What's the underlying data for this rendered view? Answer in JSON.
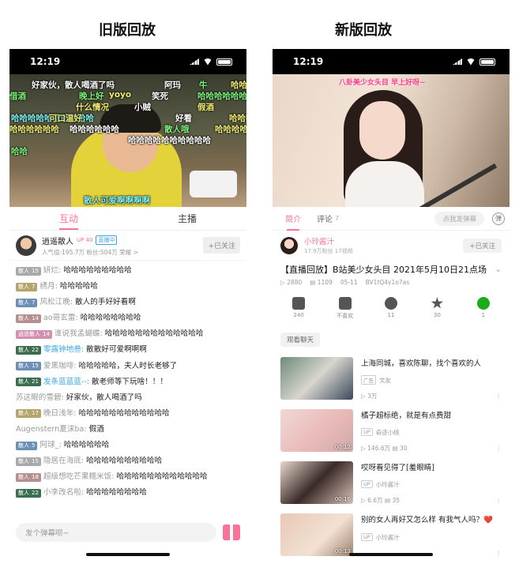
{
  "headings": {
    "old": "旧版回放",
    "new": "新版回放"
  },
  "status": {
    "time": "12:19"
  },
  "old": {
    "danmaku": [
      "好家伙，散人喝酒了吗",
      "阿玛",
      "牛",
      "哈哈",
      "借酒",
      "晚上好",
      "yoyo",
      "笑死",
      "哈哈哈哈哈哈",
      "什么情况",
      "小贼",
      "假酒",
      "哈哈哈哈哈哈哈哈哈哈",
      "可口温好",
      "好看",
      "哈哈哈哈哈",
      "哈哈哈哈哈哈",
      "哈哈哈哈哈哈",
      "散人哦",
      "哈哈哈哈哈",
      "哈哈哈哈哈哈哈哈哈哈",
      "哈哈",
      "散人可爱啊啊啊啊"
    ],
    "tabs": [
      "互动",
      "主播"
    ],
    "anchor": {
      "name": "逍遥散人",
      "level": "UP 40",
      "tag": "直播中",
      "sub": "人气值:195.7万  粉丝:504万  荣耀 >",
      "follow": "+已关注"
    },
    "chat": [
      {
        "medal": "散人",
        "lv": "15",
        "medal_color": "#a9a9a9",
        "user": "妍烂:",
        "text": "哈哈哈哈哈哈哈哈哈",
        "blue": false
      },
      {
        "medal": "散人",
        "lv": "7",
        "medal_color": "#b5a46b",
        "user": "绣月:",
        "text": "哈哈哈哈哈",
        "blue": false
      },
      {
        "medal": "散人",
        "lv": "7",
        "medal_color": "#6b8fb5",
        "user": "风松江晚:",
        "text": "散人的手好好看啊",
        "blue": false
      },
      {
        "medal": "散人",
        "lv": "14",
        "medal_color": "#b58f8f",
        "user": "ao哥玄雷:",
        "text": "哈哈哈哈哈哈哈哈",
        "blue": false
      },
      {
        "medal": "逍遥散人",
        "lv": "14",
        "medal_color": "#d38fb0",
        "user": "谁说我孟蝴蝶:",
        "text": "哈哈哈哈哈哈哈哈哈哈哈哈哈",
        "blue": false
      },
      {
        "medal": "散人",
        "lv": "22",
        "medal_color": "#3b6e4e",
        "user": "零露钟地叁:",
        "text": "散散好可爱啊啊啊",
        "blue": true
      },
      {
        "medal": "散人",
        "lv": "15",
        "medal_color": "#6b8fb5",
        "user": "爱黑咖啡:",
        "text": "哈哈哈哈哈，夫人时长老够了",
        "blue": false
      },
      {
        "medal": "散人",
        "lv": "21",
        "medal_color": "#3b6e4e",
        "user": "发条蓝蓝蓝--:",
        "text": "散老师等下玩啥！！！",
        "blue": true
      },
      {
        "medal": "",
        "lv": "",
        "medal_color": "",
        "user": "苏这眼的雪碧:",
        "text": "好家伙，散人喝酒了吗",
        "blue": false
      },
      {
        "medal": "散人",
        "lv": "17",
        "medal_color": "#b5a46b",
        "user": "晚日浅年:",
        "text": "哈哈哈哈哈哈哈哈哈哈哈哈",
        "blue": false
      },
      {
        "medal": "",
        "lv": "",
        "medal_color": "",
        "user": "Augenstern夏沫ba:",
        "text": "假酒",
        "blue": false
      },
      {
        "medal": "散人",
        "lv": "5",
        "medal_color": "#6b8fb5",
        "user": "阿球_:",
        "text": "哈哈哈哈哈哈",
        "blue": false
      },
      {
        "medal": "散人",
        "lv": "15",
        "medal_color": "#a9a9a9",
        "user": "隐居在海底:",
        "text": "哈哈哈哈哈哈哈哈哈哈",
        "blue": false
      },
      {
        "medal": "散人",
        "lv": "18",
        "medal_color": "#b58f8f",
        "user": "超级想吃芒果糯米饭:",
        "text": "哈哈哈哈哈哈哈哈哈哈哈哈",
        "blue": false
      },
      {
        "medal": "散人",
        "lv": "22",
        "medal_color": "#3b6e4e",
        "user": "小李改名啦:",
        "text": "哈哈哈哈哈哈哈哈",
        "blue": false
      }
    ],
    "input_placeholder": "发个弹幕呗~"
  },
  "new": {
    "video_overlay": "八卦美少女头目  早上好呀~",
    "tabs": {
      "intro": "简介",
      "comments": "评论",
      "comments_count": "7",
      "danmu_placeholder": "点我发弹幕",
      "danmu_toggle": "弹"
    },
    "uploader": {
      "name": "小玲酱汁",
      "sub": "17.9万粉丝  17视频",
      "follow": "+已关注"
    },
    "title": "【直播回放】B站美少女头目  2021年5月10日21点场",
    "meta": {
      "views": "2880",
      "danmaku": "1109",
      "date": "05-11",
      "bvid": "BV1tQ4y1o7as"
    },
    "actions": [
      {
        "label": "240",
        "icon": "thumbs-up-icon",
        "kind": ""
      },
      {
        "label": "不喜欢",
        "icon": "thumbs-down-icon",
        "kind": ""
      },
      {
        "label": "11",
        "icon": "coin-icon",
        "kind": "round"
      },
      {
        "label": "30",
        "icon": "star-icon",
        "kind": "star"
      },
      {
        "label": "1",
        "icon": "wechat-share-icon",
        "kind": "green"
      }
    ],
    "replay_chip": "观看聊天",
    "recommendations": [
      {
        "title": "上海同城，喜欢陈聊，找个喜欢的人",
        "up": "文友",
        "stat1": "3万",
        "stat2": "",
        "ad": "广告",
        "duration": "",
        "thumb": "linear-gradient(135deg,#6d8a7a,#d8d6cf 50%,#3a4a5a)"
      },
      {
        "title": "橘子超标绝，就是有点费甜",
        "up": "奇迹小桃",
        "stat1": "146.6万",
        "stat2": "30",
        "ad": "",
        "duration": "00:12",
        "thumb": "linear-gradient(135deg,#f1d8d6,#e8b8b5 60%,#caa)"
      },
      {
        "title": "哎呀看见得了[羞眼睛]",
        "up": "小玲酱汁",
        "stat1": "6.6万",
        "stat2": "35",
        "ad": "",
        "duration": "00:16",
        "thumb": "linear-gradient(135deg,#e8d7cc,#3a2a28 50%,#d9c2b6)"
      },
      {
        "title": "别的女人再好又怎么样  有我气人吗？",
        "up": "小玲酱汁",
        "stat1": "",
        "stat2": "",
        "ad": "",
        "duration": "00:13",
        "thumb": "linear-gradient(135deg,#e9c8b6,#f1e1d2 60%,#a08070)",
        "heart": "❤️"
      }
    ]
  }
}
